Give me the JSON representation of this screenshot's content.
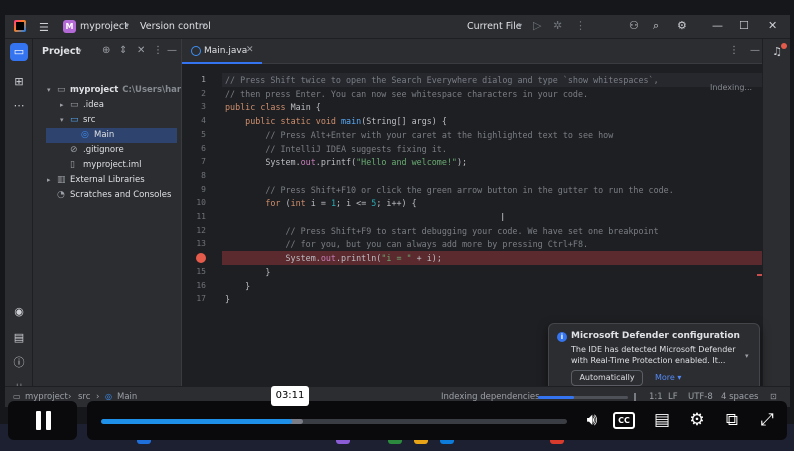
{
  "titlebar": {
    "project_initial": "M",
    "project_name": "myproject",
    "vcs_label": "Version control",
    "run_config": "Current File"
  },
  "project_panel": {
    "title": "Project",
    "tree": [
      {
        "label": "myproject",
        "path": "C:\\Users\\haris\\Ide"
      },
      {
        "label": ".idea"
      },
      {
        "label": "src"
      },
      {
        "label": "Main"
      },
      {
        "label": ".gitignore"
      },
      {
        "label": "myproject.iml"
      },
      {
        "label": "External Libraries"
      },
      {
        "label": "Scratches and Consoles"
      }
    ]
  },
  "editor": {
    "tab_label": "Main.java",
    "indexing_label": "Indexing...",
    "line_numbers": [
      "1",
      "2",
      "3",
      "4",
      "5",
      "6",
      "7",
      "8",
      "9",
      "10",
      "11",
      "12",
      "13",
      "14",
      "15",
      "16",
      "17"
    ],
    "lines": [
      "// Press Shift twice to open the Search Everywhere dialog and type `show whitespaces`,",
      "// then press Enter. You can now see whitespace characters in your code.",
      "public class Main {",
      "    public static void main(String[] args) {",
      "        // Press Alt+Enter with your caret at the highlighted text to see how",
      "        // IntelliJ IDEA suggests fixing it.",
      "        System.out.printf(\"Hello and welcome!\");",
      "",
      "        // Press Shift+F10 or click the green arrow button in the gutter to run the code.",
      "        for (int i = 1; i <= 5; i++) {",
      "",
      "            // Press Shift+F9 to start debugging your code. We have set one breakpoint",
      "            // for you, but you can always add more by pressing Ctrl+F8.",
      "            System.out.println(\"i = \" + i);",
      "        }",
      "    }",
      "}"
    ]
  },
  "notification": {
    "title": "Microsoft Defender configuration",
    "body": "The IDE has detected Microsoft Defender with Real-Time Protection enabled. It...",
    "primary_button": "Automatically",
    "more_link": "More"
  },
  "statusbar": {
    "crumb_project": "myproject",
    "crumb_src": "src",
    "crumb_main": "Main",
    "task": "Indexing dependencies",
    "position": "1:1",
    "line_ending": "LF",
    "encoding": "UTF-8",
    "indent": "4 spaces"
  },
  "player": {
    "time_tooltip": "03:11",
    "cc_label": "CC",
    "progress_fraction": 0.41,
    "buffer_fraction": 0.43
  },
  "colors": {
    "accent": "#3574f0",
    "breakpoint": "#e55b4b",
    "seek_fill": "#1e90e8"
  }
}
